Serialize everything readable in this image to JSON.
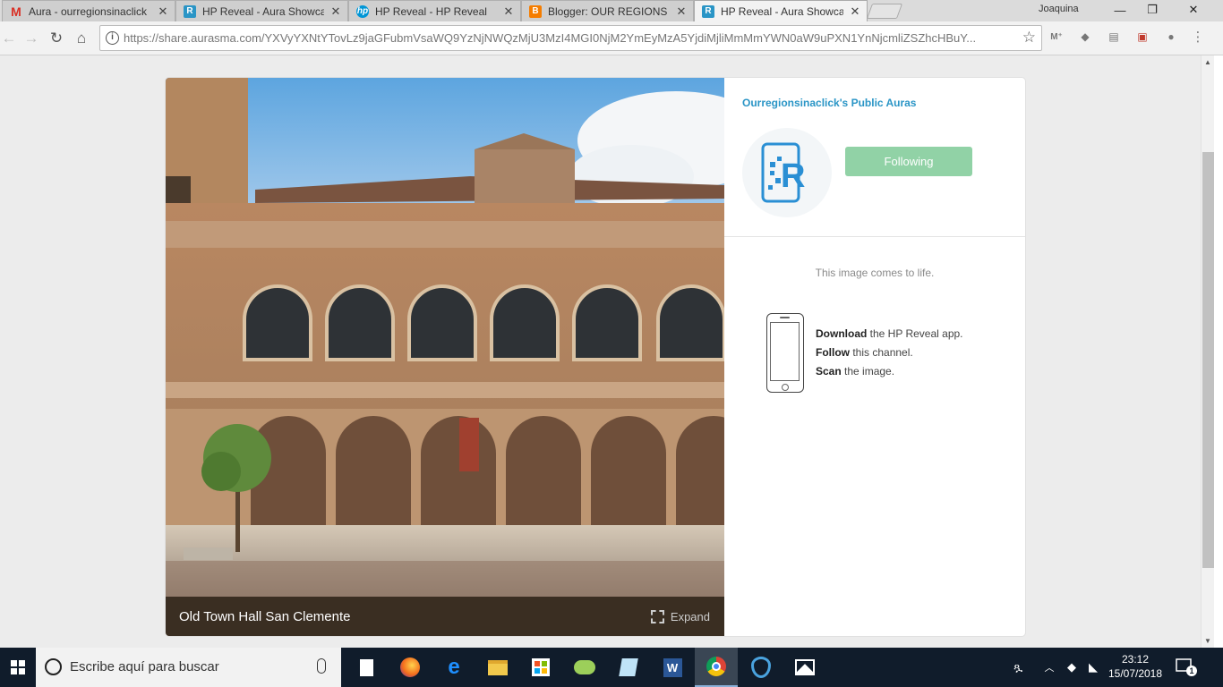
{
  "tabs": [
    {
      "label": "Aura - ourregionsinaclick",
      "favicon": "gmail-icon",
      "color": "#d93025"
    },
    {
      "label": "HP Reveal - Aura Showca",
      "favicon": "hp-reveal-icon",
      "color": "#2a95c6"
    },
    {
      "label": "HP Reveal - HP Reveal",
      "favicon": "hp-logo-icon",
      "color": "#0096d6"
    },
    {
      "label": "Blogger: OUR REGIONS I",
      "favicon": "blogger-icon",
      "color": "#f57d00"
    },
    {
      "label": "HP Reveal - Aura Showca",
      "favicon": "hp-reveal-icon",
      "color": "#2a95c6",
      "active": true
    }
  ],
  "user_name": "Joaquina",
  "window_controls": {
    "minimize": "—",
    "maximize": "❐",
    "close": "✕"
  },
  "address_bar": {
    "url": "https://share.aurasma.com/YXVyYXNtYTovLz9jaGFubmVsaWQ9YzNjNWQzMjU3MzI4MGI0NjM2YmEyMzA5YjdiMjliMmMmYWN0aW9uPXN1YnNjcmliZSZhcHBuY..."
  },
  "aura": {
    "image_caption": "Old Town Hall San Clemente",
    "expand_label": "Expand",
    "channel_title": "Ourregionsinaclick's Public Auras",
    "follow_button": "Following",
    "follow_color": "#91d2a6",
    "tagline": "This image comes to life.",
    "steps": [
      {
        "bold": "Download",
        "rest": " the HP Reveal app."
      },
      {
        "bold": "Follow",
        "rest": " this channel."
      },
      {
        "bold": "Scan",
        "rest": " the image."
      }
    ]
  },
  "taskbar": {
    "search_placeholder": "Escribe aquí para buscar",
    "time": "23:12",
    "date": "15/07/2018",
    "notification_count": "1",
    "apps": [
      "file-icon",
      "firefox-icon",
      "edge-icon",
      "file-explorer-icon",
      "store-icon",
      "game-icon",
      "notepad-icon",
      "word-icon",
      "chrome-icon",
      "shield-app-icon",
      "photos-icon"
    ]
  }
}
